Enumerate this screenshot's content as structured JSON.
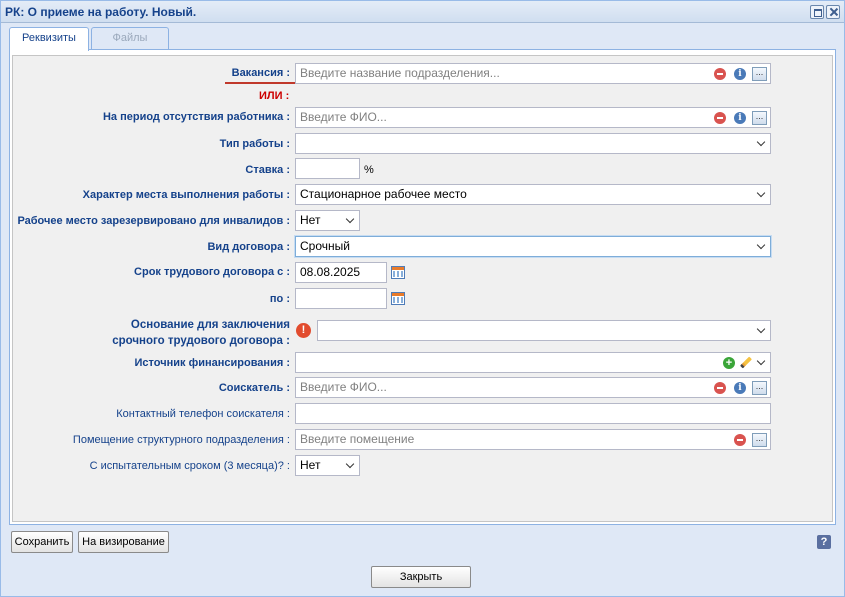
{
  "window": {
    "title": "РК: О приеме на работу. Новый."
  },
  "tabs": [
    {
      "label": "Реквизиты",
      "active": true
    },
    {
      "label": "Файлы",
      "active": false
    }
  ],
  "form": {
    "vacancy": {
      "label": "Вакансия",
      "placeholder": "Введите название подразделения..."
    },
    "or_text": "ИЛИ",
    "absence_period": {
      "label": "На период отсутствия работника",
      "placeholder": "Введите ФИО..."
    },
    "work_type": {
      "label": "Тип работы",
      "value": ""
    },
    "rate": {
      "label": "Ставка",
      "value": "",
      "unit": "%"
    },
    "workplace_nature": {
      "label": "Характер места выполнения работы",
      "value": "Стационарное рабочее место"
    },
    "reserved_disabled": {
      "label": "Рабочее место зарезервировано для инвалидов",
      "value": "Нет"
    },
    "contract_type": {
      "label": "Вид договора",
      "value": "Срочный"
    },
    "contract_from": {
      "label": "Срок трудового договора с",
      "value": "08.08.2025"
    },
    "contract_to": {
      "label": "по",
      "value": ""
    },
    "basis": {
      "label_line1": "Основание для заключения",
      "label_line2": "срочного трудового договора",
      "value": ""
    },
    "funding_source": {
      "label": "Источник финансирования",
      "value": ""
    },
    "applicant": {
      "label": "Соискатель",
      "placeholder": "Введите ФИО..."
    },
    "applicant_phone": {
      "label": "Контактный телефон соискателя",
      "value": ""
    },
    "premises": {
      "label": "Помещение структурного подразделения",
      "placeholder": "Введите помещение"
    },
    "probation": {
      "label": "С испытательным сроком (3 месяца)?",
      "value": "Нет"
    }
  },
  "footer": {
    "save_label": "Сохранить",
    "approve_label": "На визирование",
    "close_label": "Закрыть",
    "help_label": "?"
  },
  "icons": {
    "minimize": "maximize-icon",
    "close": "close-icon",
    "clear": "minus-circle-icon",
    "info": "info-icon",
    "ellipsis": "ellipsis-button",
    "calendar": "calendar-icon",
    "add": "plus-circle-icon",
    "edit": "pencil-icon",
    "warning": "warning-icon",
    "help": "help-icon"
  },
  "colors": {
    "title": "#15428b",
    "required_underline": "#c0392b",
    "or_text": "#cc0000",
    "window_bg": "#dfe8f6"
  }
}
